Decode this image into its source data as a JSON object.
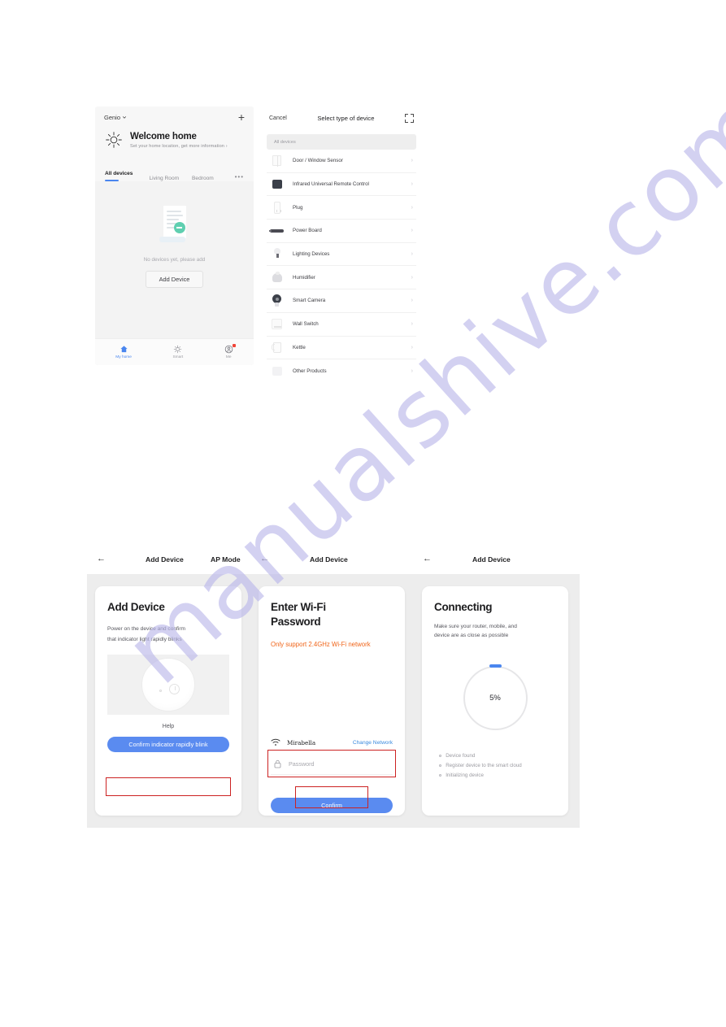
{
  "watermark": {
    "text": "manualshive.com"
  },
  "home_screen": {
    "app_name": "Genio",
    "dropdown_icon": "chevron-down-icon",
    "add_icon": "plus-icon",
    "sun_icon": "sun-icon",
    "welcome_title": "Welcome home",
    "welcome_subtitle": "Set your home location, get more information",
    "subtitle_chevron": "›",
    "tabs": [
      {
        "label": "All devices",
        "active": true
      },
      {
        "label": "Living Room",
        "active": false
      },
      {
        "label": "Bedroom",
        "active": false
      }
    ],
    "tabs_more": "•••",
    "empty_text": "No devices yet, please add",
    "add_device_button": "Add Device",
    "bottom_nav": [
      {
        "label": "My home",
        "icon": "home-icon",
        "active": true,
        "badge": false
      },
      {
        "label": "Smart",
        "icon": "sun-icon",
        "active": false,
        "badge": false
      },
      {
        "label": "Me",
        "icon": "profile-icon",
        "active": false,
        "badge": true
      }
    ]
  },
  "select_device_screen": {
    "cancel": "Cancel",
    "title": "Select type of device",
    "scan_icon": "scan-qr-icon",
    "section_label": "All devices",
    "chevron": "›",
    "items": [
      {
        "label": "Door / Window Sensor",
        "icon": "door-window-sensor-icon"
      },
      {
        "label": "Infrared Universal Remote Control",
        "icon": "infrared-remote-icon"
      },
      {
        "label": "Plug",
        "icon": "plug-icon"
      },
      {
        "label": "Power Board",
        "icon": "power-board-icon"
      },
      {
        "label": "Lighting Devices",
        "icon": "light-bulb-icon"
      },
      {
        "label": "Humidifier",
        "icon": "humidifier-icon"
      },
      {
        "label": "Smart Camera",
        "icon": "camera-icon"
      },
      {
        "label": "Wall Switch",
        "icon": "wall-switch-icon"
      },
      {
        "label": "Kettle",
        "icon": "kettle-icon"
      },
      {
        "label": "Other Products",
        "icon": "other-products-icon"
      }
    ]
  },
  "bottom_headers": {
    "h1_back": "←",
    "h1_title": "Add Device",
    "h1_mode": "AP Mode",
    "h2_back": "←",
    "h2_title": "Add Device",
    "h3_back": "←",
    "h3_title": "Add Device"
  },
  "add_device_card": {
    "title": "Add Device",
    "line1": "Power on the device and confirm",
    "line2": "that indicator light rapidly blinks",
    "device_image": "smart-switch-device-image",
    "help_link": "Help",
    "confirm_button": "Confirm indicator rapidly blink"
  },
  "wifi_card": {
    "title_line1": "Enter Wi-Fi",
    "title_line2": "Password",
    "note": "Only support 2.4GHz Wi-Fi network",
    "wifi_icon": "wifi-icon",
    "ssid": "Mirabella",
    "change_network": "Change Network",
    "lock_icon": "lock-icon",
    "password_placeholder": "Password",
    "password_value": "",
    "confirm_button": "Confirm"
  },
  "connecting_card": {
    "title": "Connecting",
    "line1": "Make sure your router, mobile, and",
    "line2": "device are as close as possible",
    "progress_percent": "5%",
    "progress_value": 5,
    "steps": [
      "Device found",
      "Register device to the smart cloud",
      "Initializing device"
    ]
  },
  "colors": {
    "accent_blue": "#4a86ef",
    "button_blue": "#5a8bf0",
    "warning_orange": "#f0651a",
    "annotation_red": "#cc2222",
    "link_blue": "#3a8ade",
    "badge_red": "#f04438"
  }
}
